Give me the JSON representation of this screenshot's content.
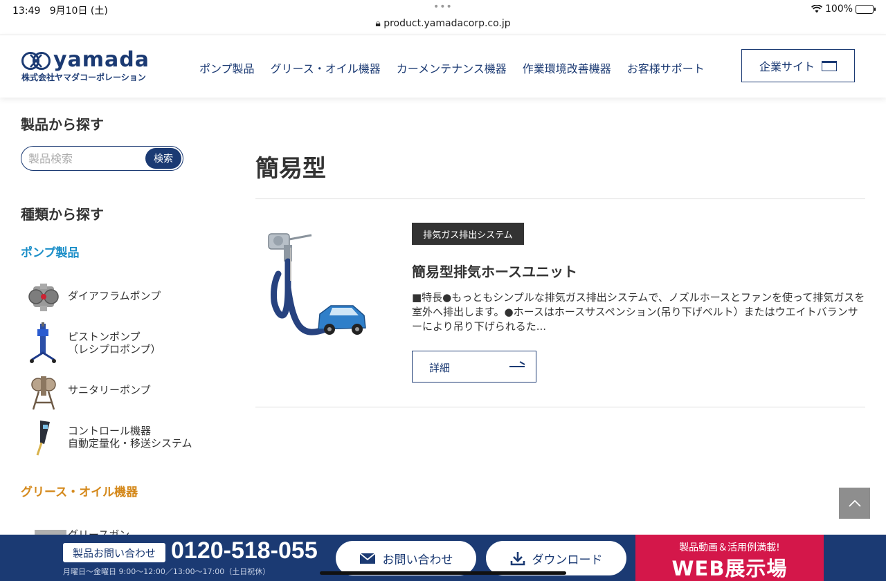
{
  "status_bar": {
    "time": "13:49",
    "date": "9月10日 (土)",
    "url": "product.yamadacorp.co.jp",
    "battery": "100%"
  },
  "header": {
    "logo_text": "yamada",
    "logo_sub": "株式会社ヤマダコーポレーション",
    "nav": [
      "ポンプ製品",
      "グリース・オイル機器",
      "カーメンテナンス機器",
      "作業環境改善機器",
      "お客様サポート"
    ],
    "corporate_button": "企業サイト"
  },
  "sidebar": {
    "search_heading": "製品から探す",
    "search_placeholder": "製品検索",
    "search_button": "検索",
    "category_heading": "種類から探す",
    "pump_category": "ポンプ製品",
    "pump_items": [
      {
        "line1": "ダイアフラムポンプ",
        "line2": ""
      },
      {
        "line1": "ピストンポンプ",
        "line2": "（レシプロポンプ）"
      },
      {
        "line1": "サニタリーポンプ",
        "line2": ""
      },
      {
        "line1": "コントロール機器",
        "line2": "自動定量化・移送システム"
      }
    ],
    "grease_category": "グリース・オイル機器",
    "grease_partial_item": "グリースガン"
  },
  "main": {
    "title": "簡易型",
    "product": {
      "tag": "排気ガス排出システム",
      "name": "簡易型排気ホースユニット",
      "description": "■特長●もっともシンプルな排気ガス排出システムで、ノズルホースとファンを使って排気ガスを室外へ排出します。●ホースはホースサスペンション(吊り下げベルト）またはウエイトバランサーにより吊り下げられるた...",
      "detail_button": "詳細"
    }
  },
  "footer_bar": {
    "contact_label": "製品お問い合わせ",
    "phone": "0120-518-055",
    "hours": "月曜日〜金曜日 9:00〜12:00／13:00〜17:00（土日祝休）",
    "inquiry_button": "お問い合わせ",
    "download_button": "ダウンロード",
    "web_showroom_sub": "製品動画＆活用例満載!",
    "web_showroom_main": "WEB展示場"
  },
  "colors": {
    "brand_navy": "#1b3a73",
    "pump_blue": "#1a8ec8",
    "grease_orange": "#d4881a",
    "showroom_red": "#d4174a"
  }
}
